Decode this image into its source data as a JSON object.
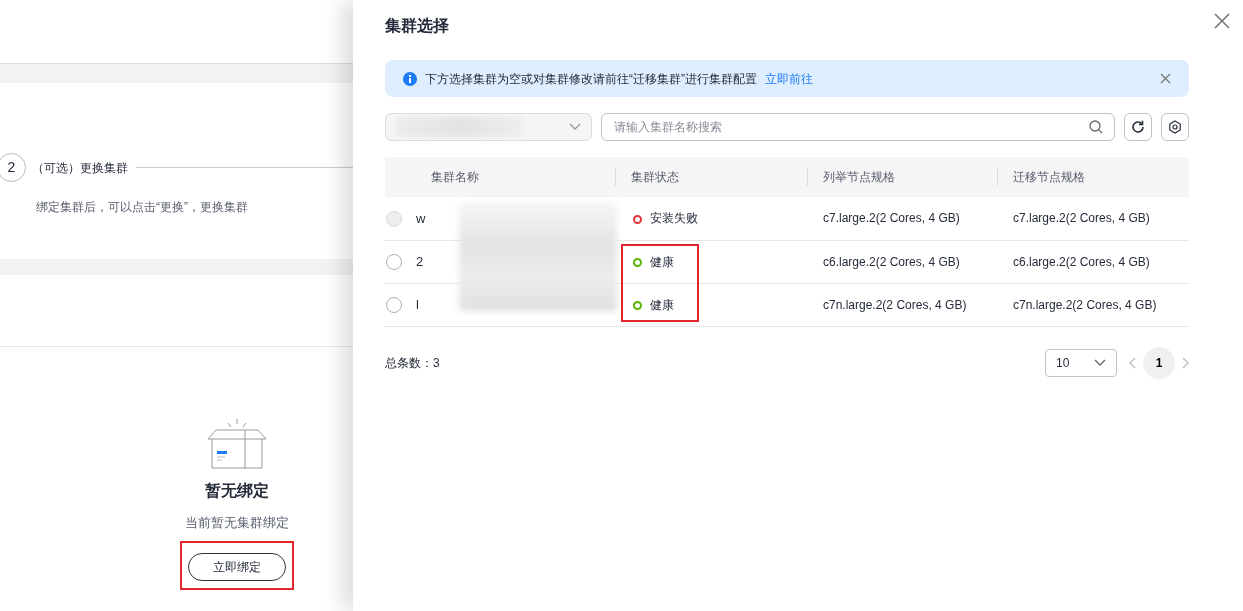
{
  "left_panel": {
    "step": {
      "number": "2",
      "title": "（可选）更换集群",
      "description": "绑定集群后，可以点击“更换”，更换集群"
    },
    "empty_state": {
      "title": "暂无绑定",
      "subtitle": "当前暂无集群绑定",
      "button": {
        "label": "立即绑定",
        "highlighted": true
      }
    }
  },
  "drawer": {
    "title": "集群选择",
    "alert": {
      "text": "下方选择集群为空或对集群修改请前往“迁移集群”进行集群配置",
      "link": "立即前往"
    },
    "search": {
      "placeholder": "请输入集群名称搜索"
    },
    "table": {
      "columns": [
        "集群名称",
        "集群状态",
        "列举节点规格",
        "迁移节点规格"
      ],
      "rows": [
        {
          "name": "w",
          "selected": false,
          "disabled": true,
          "status": "安装失败",
          "color": "#e8343a",
          "status_highlighted": false,
          "spec": "c7.large.2(2 Cores, 4 GB)",
          "migrate_spec": "c7.large.2(2 Cores, 4 GB)"
        },
        {
          "name": "2",
          "selected": false,
          "disabled": false,
          "status": "健康",
          "color": "#5cb300",
          "status_highlighted": true,
          "spec": "c6.large.2(2 Cores, 4 GB)",
          "migrate_spec": "c6.large.2(2 Cores, 4 GB)"
        },
        {
          "name": "l",
          "selected": false,
          "disabled": false,
          "status": "健康",
          "color": "#5cb300",
          "status_highlighted": true,
          "spec": "c7n.large.2(2 Cores, 4 GB)",
          "migrate_spec": "c7n.large.2(2 Cores, 4 GB)"
        }
      ]
    },
    "footer": {
      "total": "总条数：3",
      "page_size": "10",
      "pages": [
        {
          "label": "1",
          "selected": true
        }
      ]
    }
  }
}
